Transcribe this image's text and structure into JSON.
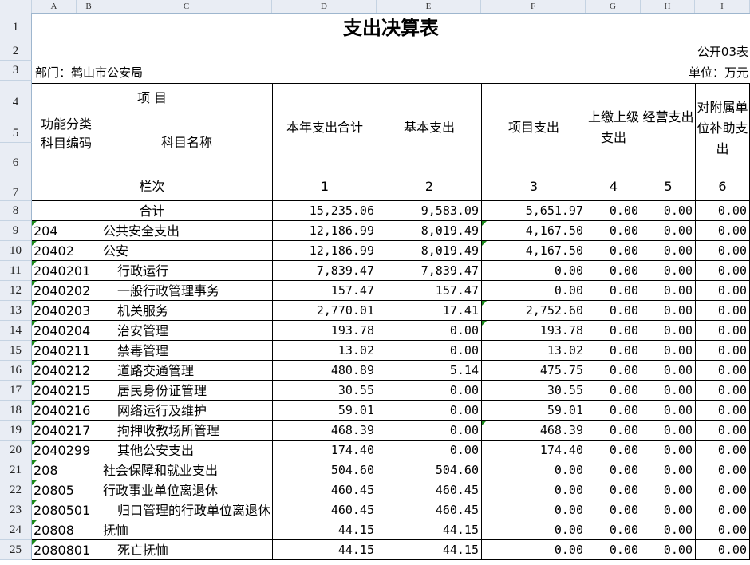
{
  "col_headers": [
    "A",
    "B",
    "C",
    "D",
    "E",
    "F",
    "G",
    "H",
    "I"
  ],
  "title": "支出决算表",
  "form_no": "公开03表",
  "department": "部门：鹤山市公安局",
  "unit": "单位：万元",
  "header": {
    "item": "项    目",
    "code": "功能分类科目编码",
    "name": "科目名称",
    "total": "本年支出合计",
    "basic": "基本支出",
    "project": "项目支出",
    "upper": "上缴上级支出",
    "business": "经营支出",
    "subsidy": "对附属单位补助支出",
    "col_label": "栏次",
    "col_nums": [
      "1",
      "2",
      "3",
      "4",
      "5",
      "6"
    ]
  },
  "total_row": {
    "label": "合计",
    "values": [
      "15,235.06",
      "9,583.09",
      "5,651.97",
      "0.00",
      "0.00",
      "0.00"
    ]
  },
  "rows": [
    {
      "code": "204",
      "name": "公共安全支出",
      "indent": false,
      "values": [
        "12,186.99",
        "8,019.49",
        "4,167.50",
        "0.00",
        "0.00",
        "0.00"
      ]
    },
    {
      "code": "20402",
      "name": "公安",
      "indent": false,
      "values": [
        "12,186.99",
        "8,019.49",
        "4,167.50",
        "0.00",
        "0.00",
        "0.00"
      ]
    },
    {
      "code": "2040201",
      "name": "行政运行",
      "indent": true,
      "values": [
        "7,839.47",
        "7,839.47",
        "0.00",
        "0.00",
        "0.00",
        "0.00"
      ]
    },
    {
      "code": "2040202",
      "name": "一般行政管理事务",
      "indent": true,
      "values": [
        "157.47",
        "157.47",
        "0.00",
        "0.00",
        "0.00",
        "0.00"
      ]
    },
    {
      "code": "2040203",
      "name": "机关服务",
      "indent": true,
      "values": [
        "2,770.01",
        "17.41",
        "2,752.60",
        "0.00",
        "0.00",
        "0.00"
      ]
    },
    {
      "code": "2040204",
      "name": "治安管理",
      "indent": true,
      "values": [
        "193.78",
        "0.00",
        "193.78",
        "0.00",
        "0.00",
        "0.00"
      ]
    },
    {
      "code": "2040211",
      "name": "禁毒管理",
      "indent": true,
      "values": [
        "13.02",
        "0.00",
        "13.02",
        "0.00",
        "0.00",
        "0.00"
      ]
    },
    {
      "code": "2040212",
      "name": "道路交通管理",
      "indent": true,
      "values": [
        "480.89",
        "5.14",
        "475.75",
        "0.00",
        "0.00",
        "0.00"
      ]
    },
    {
      "code": "2040215",
      "name": "居民身份证管理",
      "indent": true,
      "values": [
        "30.55",
        "0.00",
        "30.55",
        "0.00",
        "0.00",
        "0.00"
      ]
    },
    {
      "code": "2040216",
      "name": "网络运行及维护",
      "indent": true,
      "values": [
        "59.01",
        "0.00",
        "59.01",
        "0.00",
        "0.00",
        "0.00"
      ]
    },
    {
      "code": "2040217",
      "name": "拘押收教场所管理",
      "indent": true,
      "values": [
        "468.39",
        "0.00",
        "468.39",
        "0.00",
        "0.00",
        "0.00"
      ]
    },
    {
      "code": "2040299",
      "name": "其他公安支出",
      "indent": true,
      "values": [
        "174.40",
        "0.00",
        "174.40",
        "0.00",
        "0.00",
        "0.00"
      ]
    },
    {
      "code": "208",
      "name": "社会保障和就业支出",
      "indent": false,
      "values": [
        "504.60",
        "504.60",
        "0.00",
        "0.00",
        "0.00",
        "0.00"
      ]
    },
    {
      "code": "20805",
      "name": "行政事业单位离退休",
      "indent": false,
      "values": [
        "460.45",
        "460.45",
        "0.00",
        "0.00",
        "0.00",
        "0.00"
      ]
    },
    {
      "code": "2080501",
      "name": "归口管理的行政单位离退休",
      "indent": true,
      "values": [
        "460.45",
        "460.45",
        "0.00",
        "0.00",
        "0.00",
        "0.00"
      ]
    },
    {
      "code": "20808",
      "name": "抚恤",
      "indent": false,
      "values": [
        "44.15",
        "44.15",
        "0.00",
        "0.00",
        "0.00",
        "0.00"
      ]
    },
    {
      "code": "2080801",
      "name": "死亡抚恤",
      "indent": true,
      "values": [
        "44.15",
        "44.15",
        "0.00",
        "0.00",
        "0.00",
        "0.00"
      ]
    }
  ],
  "row_numbers": [
    "1",
    "2",
    "3",
    "4",
    "5",
    "6",
    "7",
    "8",
    "9",
    "10",
    "11",
    "12",
    "13",
    "14",
    "15",
    "16",
    "17",
    "18",
    "19",
    "20",
    "21",
    "22",
    "23",
    "24",
    "25"
  ]
}
